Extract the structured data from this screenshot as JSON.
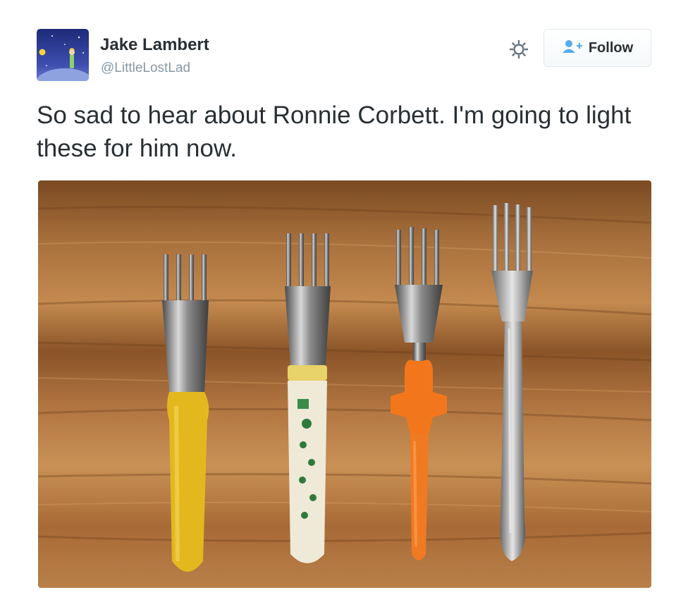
{
  "tweet": {
    "author_name": "Jake Lambert",
    "author_handle": "@LittleLostLad",
    "text": "So sad to hear about Ronnie Corbett. I'm going to light these for him now."
  },
  "actions": {
    "settings_icon": "gear-icon",
    "follow_label": "Follow",
    "follow_icon": "add-user-icon"
  },
  "colors": {
    "name_text": "#292f33",
    "handle_text": "#8899a6",
    "follow_icon": "#55acee",
    "button_border": "#e1e8ed"
  }
}
